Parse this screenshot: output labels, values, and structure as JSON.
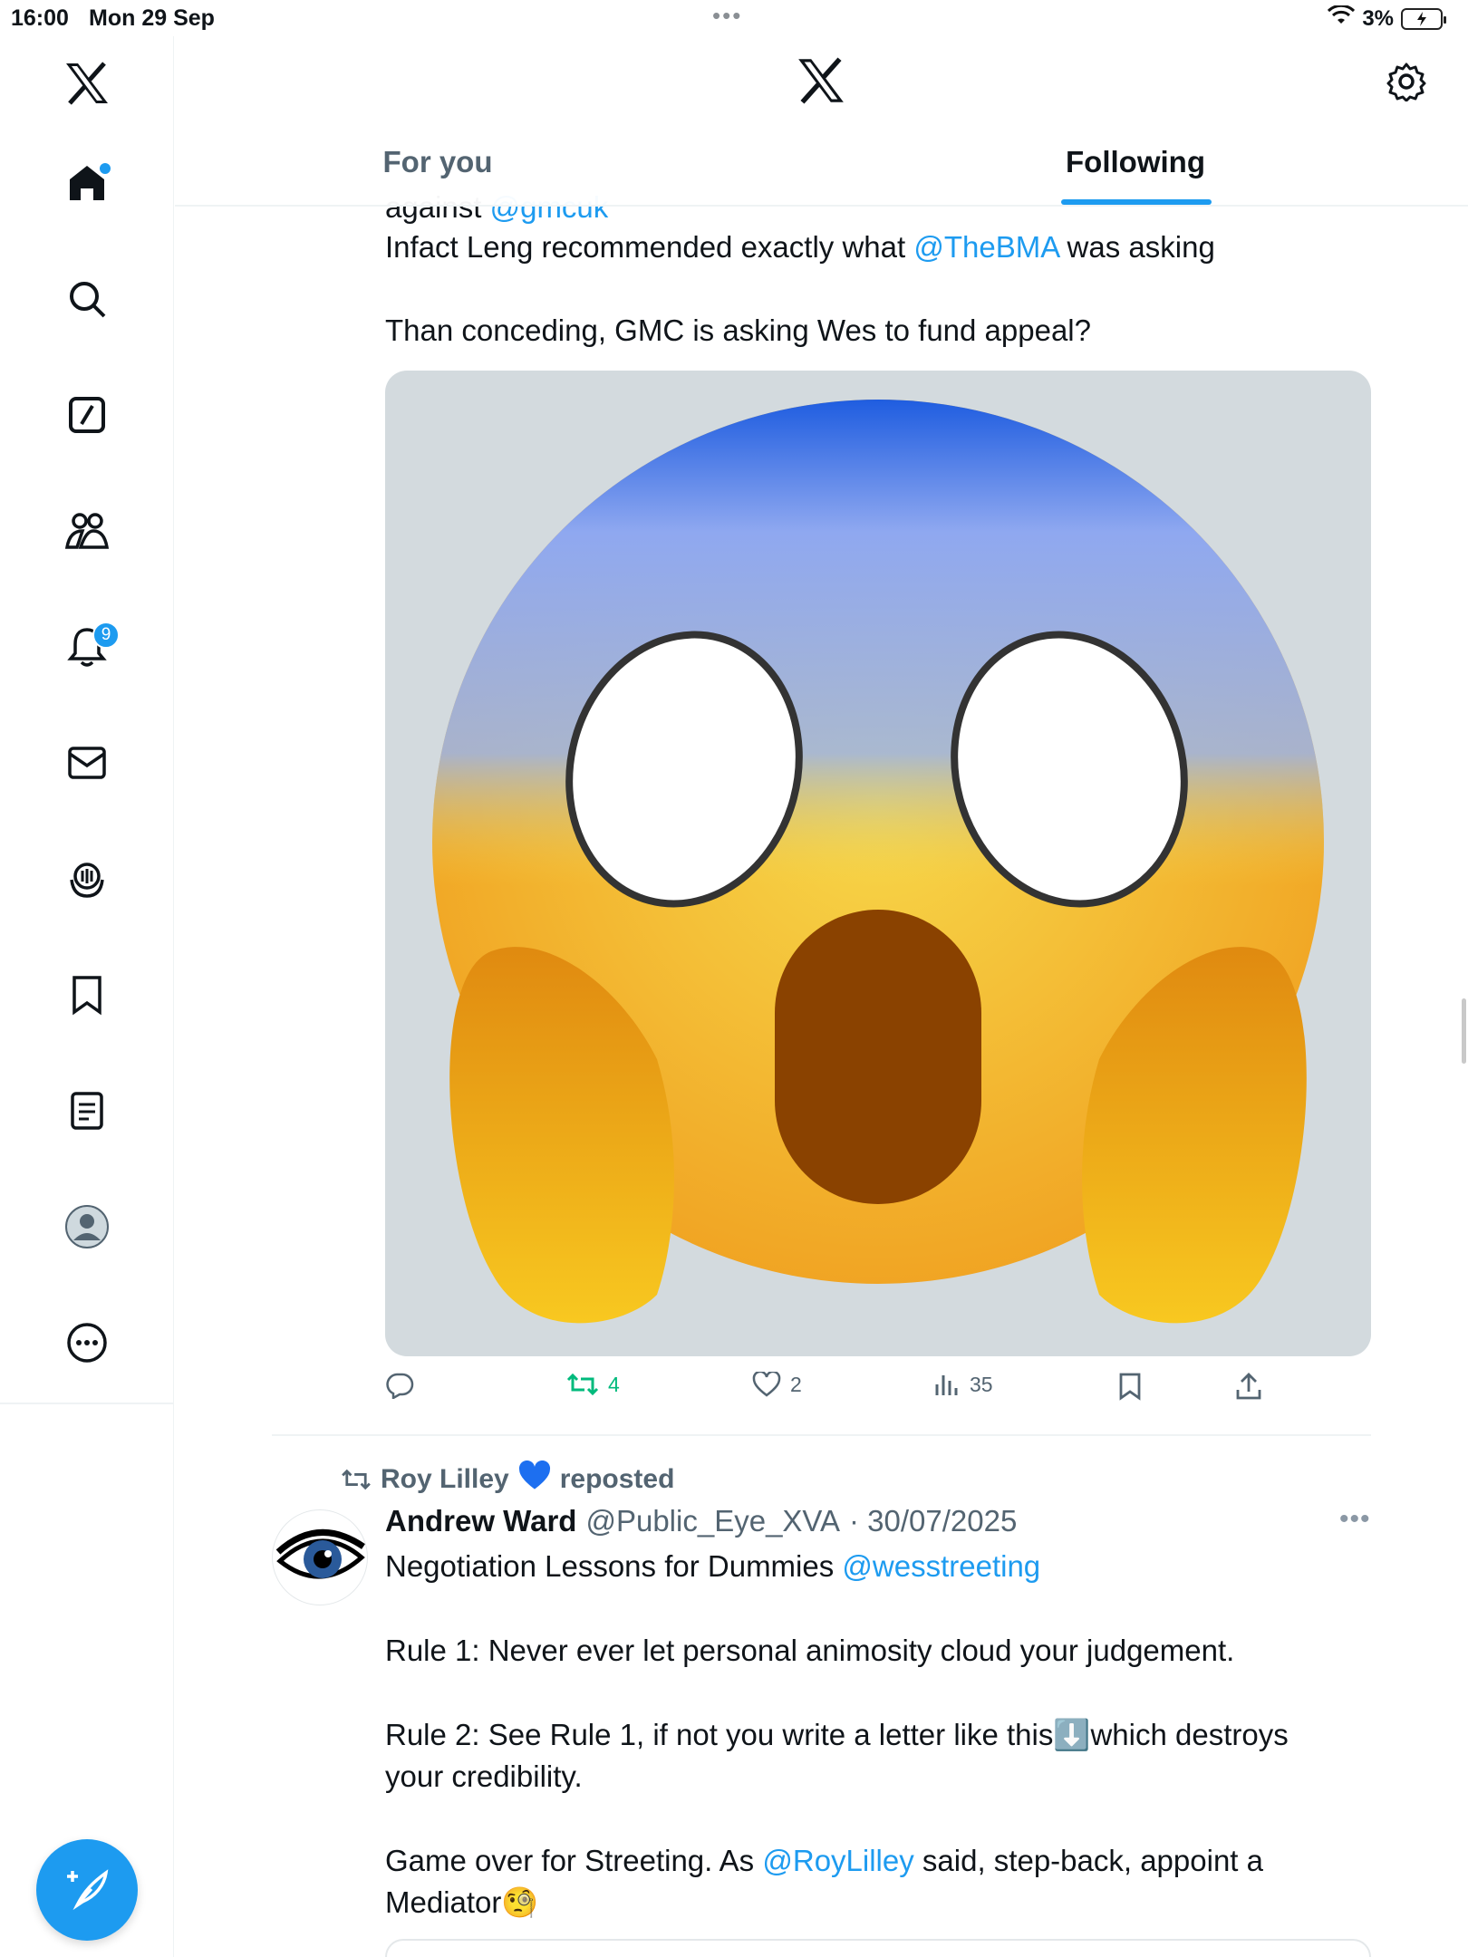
{
  "status_bar": {
    "time": "16:00",
    "date": "Mon 29 Sep",
    "battery_pct": "3%"
  },
  "sidebar": {
    "items": [
      {
        "icon": "x-logo-icon"
      },
      {
        "icon": "home-icon",
        "has_dot": true
      },
      {
        "icon": "search-icon"
      },
      {
        "icon": "grok-icon"
      },
      {
        "icon": "communities-icon"
      },
      {
        "icon": "notifications-icon",
        "count": "9"
      },
      {
        "icon": "messages-icon"
      },
      {
        "icon": "spaces-icon"
      },
      {
        "icon": "bookmarks-icon"
      },
      {
        "icon": "lists-icon"
      },
      {
        "icon": "profile-icon"
      },
      {
        "icon": "more-icon"
      }
    ],
    "compose_icon": "compose-icon"
  },
  "header": {
    "tabs": [
      {
        "label": "For you",
        "active": false
      },
      {
        "label": "Following",
        "active": true
      }
    ]
  },
  "post1": {
    "cut_prefix": "against ",
    "cut_mention": "@gmcuk",
    "line1_pre": "Infact Leng recommended exactly what ",
    "line1_mention": "@TheBMA",
    "line1_post": " was asking",
    "line2": "Than conceding, GMC is asking Wes to fund appeal?",
    "media_description_icon": "screaming-face-emoji-icon",
    "actions": {
      "replies": "",
      "retweets": "4",
      "likes": "2",
      "views": "35"
    }
  },
  "post2": {
    "reposted_by": "Roy Lilley",
    "reposted_label": "reposted",
    "author_name": "Andrew Ward",
    "author_handle": "@Public_Eye_XVA",
    "date": "· 30/07/2025",
    "line1_pre": "Negotiation Lessons for Dummies ",
    "line1_mention": "@wesstreeting",
    "rule1": "Rule 1: Never ever let personal animosity cloud your judgement.",
    "rule2_pre": "Rule 2: See Rule 1, if not you write a letter like this",
    "rule2_emoji": "⬇️",
    "rule2_post": "which destroys",
    "rule2_line2": "your credibility.",
    "game_pre": "Game over for Streeting. As ",
    "game_mention": "@RoyLilley",
    "game_post": " said, step-back, appoint a",
    "mediator": "Mediator",
    "mediator_emoji": "🧐"
  },
  "colors": {
    "accent": "#1d9bf0",
    "text": "#0f1419",
    "secondary": "#536471",
    "retweet_green": "#00ba7c"
  }
}
